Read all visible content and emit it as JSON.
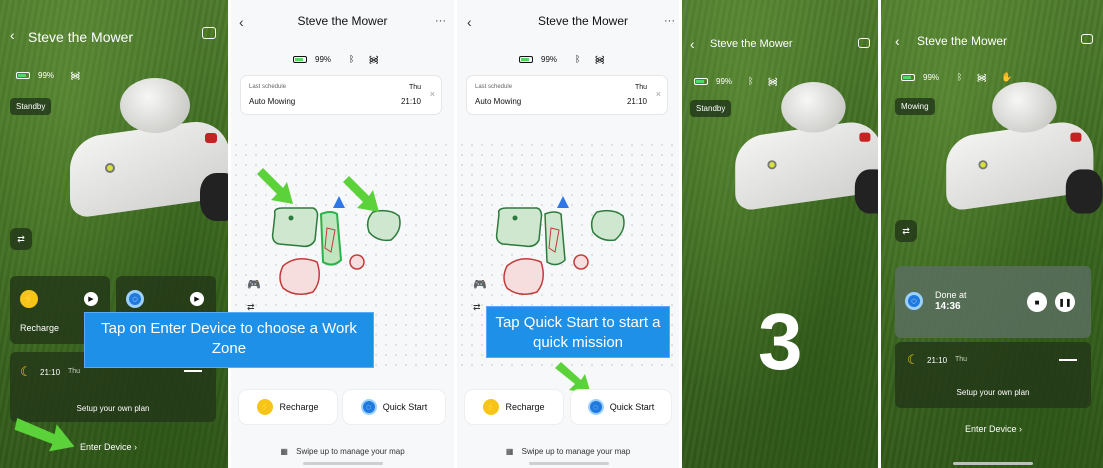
{
  "panel1": {
    "title": "Steve the Mower",
    "battery": "99%",
    "status_pill": "Standby",
    "recharge_label": "Recharge",
    "schedule_time": "21:10",
    "schedule_day": "Thu",
    "setup_plan": "Setup your own plan",
    "enter_device": "Enter Device"
  },
  "panel2": {
    "title": "Steve the Mower",
    "battery": "99%",
    "schedule_label": "Last schedule",
    "schedule_name": "Auto Mowing",
    "schedule_day": "Thu",
    "schedule_time": "21:10",
    "recharge": "Recharge",
    "quick_start": "Quick Start",
    "swipe": "Swipe up to manage your map",
    "callout": "Tap on Enter Device to choose a Work Zone"
  },
  "panel3": {
    "title": "Steve the Mower",
    "battery": "99%",
    "schedule_label": "Last schedule",
    "schedule_name": "Auto Mowing",
    "schedule_day": "Thu",
    "schedule_time": "21:10",
    "recharge": "Recharge",
    "quick_start": "Quick Start",
    "swipe": "Swipe up to manage your map",
    "callout": "Tap Quick Start to start a quick mission"
  },
  "panel4": {
    "title": "Steve the Mower",
    "battery": "99%",
    "status_pill": "Standby",
    "step_number": "3"
  },
  "panel5": {
    "title": "Steve the Mower",
    "battery": "99%",
    "status_pill": "Mowing",
    "done_label": "Done at",
    "done_time": "14:36",
    "schedule_time": "21:10",
    "schedule_day": "Thu",
    "setup_plan": "Setup your own plan",
    "enter_device": "Enter Device"
  },
  "colors": {
    "accent_yellow": "#f6c518",
    "accent_blue": "#1f7ae0",
    "callout_blue": "#1e90e8",
    "arrow_green": "#5bd13a"
  }
}
